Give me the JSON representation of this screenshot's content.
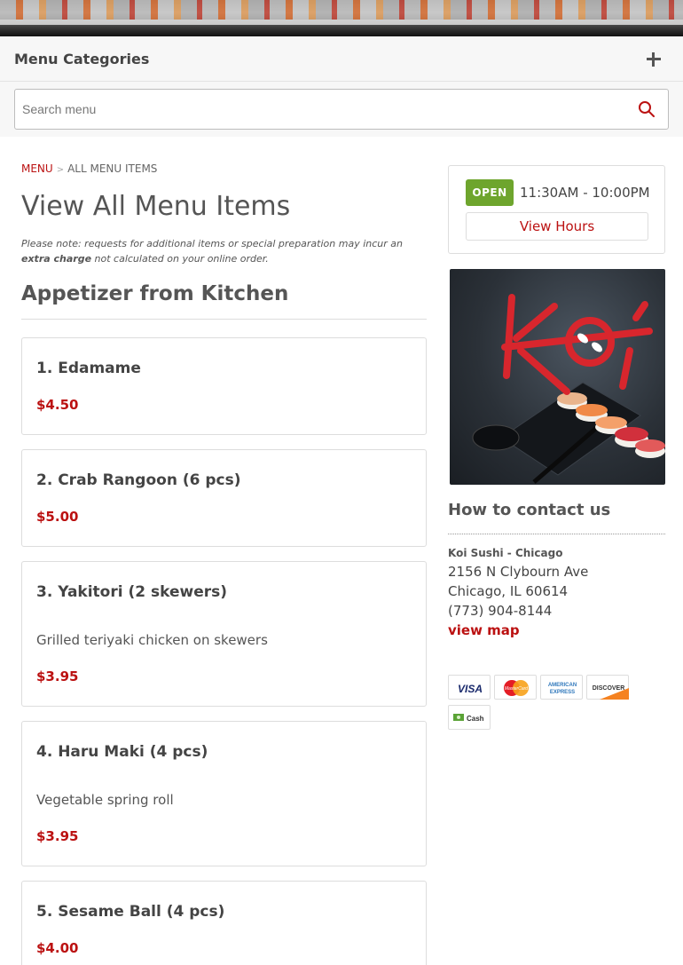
{
  "header": {
    "categories_label": "Menu Categories"
  },
  "search": {
    "placeholder": "Search menu"
  },
  "breadcrumb": {
    "root": "MENU",
    "current": "ALL MENU ITEMS"
  },
  "page": {
    "title": "View All Menu Items",
    "note_prefix": "Please note: requests for additional items or special preparation may incur an ",
    "note_bold": "extra charge",
    "note_suffix": " not calculated on your online order."
  },
  "section": {
    "title": "Appetizer from Kitchen"
  },
  "items": [
    {
      "name": "1. Edamame",
      "description": "",
      "price": "$4.50"
    },
    {
      "name": "2. Crab Rangoon (6 pcs)",
      "description": "",
      "price": "$5.00"
    },
    {
      "name": "3. Yakitori (2 skewers)",
      "description": "Grilled teriyaki chicken on skewers",
      "price": "$3.95"
    },
    {
      "name": "4. Haru Maki (4 pcs)",
      "description": "Vegetable spring roll",
      "price": "$3.95"
    },
    {
      "name": "5. Sesame Ball (4 pcs)",
      "description": "",
      "price": "$4.00"
    }
  ],
  "hours": {
    "status": "OPEN",
    "range": "11:30AM - 10:00PM",
    "button": "View Hours"
  },
  "logo": {
    "text": "Koi"
  },
  "contact": {
    "title": "How to contact us",
    "name": "Koi Sushi - Chicago",
    "street": "2156 N Clybourn Ave",
    "city": "Chicago, IL 60614",
    "phone": "(773) 904-8144",
    "map_link": "view map"
  },
  "payments": {
    "visa": "VISA",
    "mastercard": "MasterCard",
    "amex_line1": "AMERICAN",
    "amex_line2": "EXPRESS",
    "discover": "DISCOVER",
    "cash": "Cash"
  },
  "colors": {
    "accent": "#bb1111",
    "open_green": "#6ea52d",
    "text": "#444444"
  }
}
